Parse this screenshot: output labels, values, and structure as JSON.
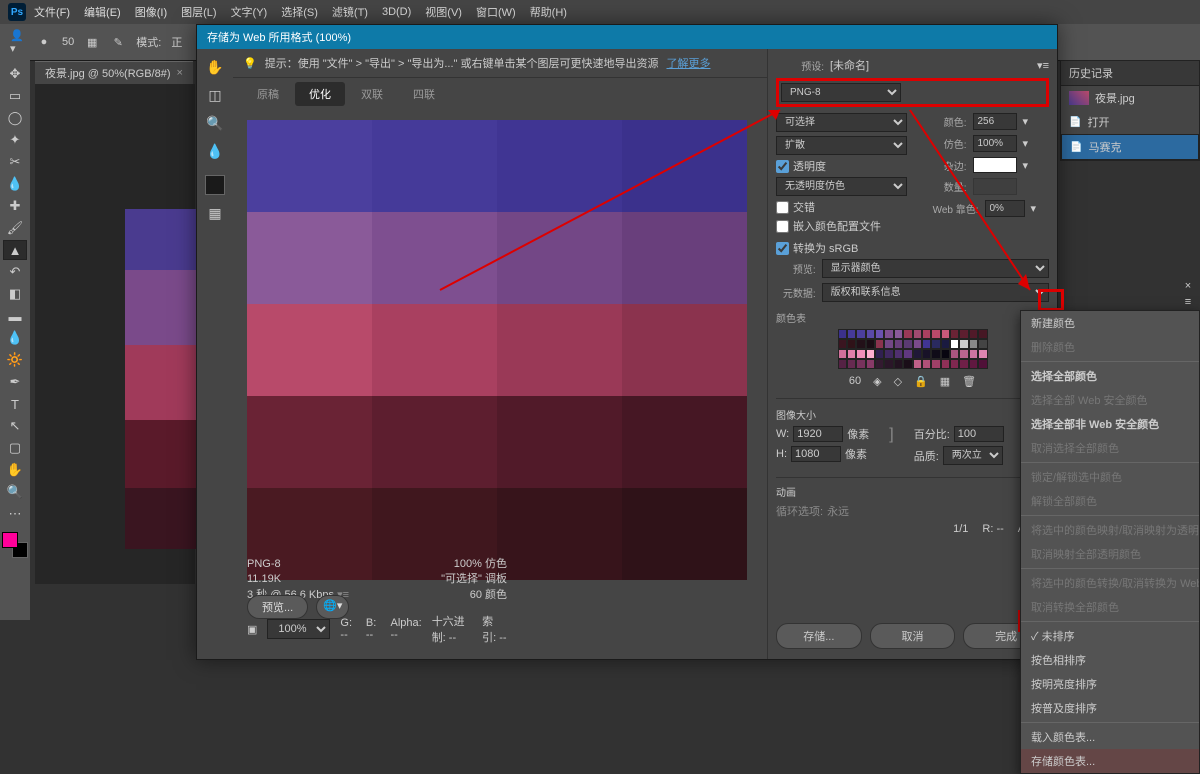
{
  "app": {
    "title": "Ps"
  },
  "menu": [
    "文件(F)",
    "编辑(E)",
    "图像(I)",
    "图层(L)",
    "文字(Y)",
    "选择(S)",
    "滤镜(T)",
    "3D(D)",
    "视图(V)",
    "窗口(W)",
    "帮助(H)"
  ],
  "optbar": {
    "brush_size": "50",
    "mode_label": "模式:",
    "mode_value": "正"
  },
  "doctab": {
    "name": "夜景.jpg @ 50%(RGB/8#)",
    "close": "×"
  },
  "dialog": {
    "title": "存储为 Web 所用格式 (100%)",
    "hint_text": "提示：使用 \"文件\" > \"导出\" > \"导出为...\" 或右键单击某个图层可更快速地导出资源",
    "hint_link": "了解更多",
    "tabs": [
      "原稿",
      "优化",
      "双联",
      "四联"
    ],
    "info": {
      "format": "PNG-8",
      "size": "11.19K",
      "time": "3 秒 @ 56.6 Kbps"
    },
    "info2": {
      "dither": "100% 仿色",
      "palette": "\"可选择\" 调板",
      "colors": "60 颜色"
    },
    "zoom": "100%",
    "readouts": {
      "g": "G: --",
      "b": "B: --",
      "alpha": "Alpha: --",
      "hex": "十六进制: --",
      "index": "索引: --"
    },
    "preview_btn": "预览...",
    "btns": {
      "save": "存储...",
      "cancel": "取消",
      "done": "完成"
    }
  },
  "settings": {
    "preset_label": "预设:",
    "preset_value": "[未命名]",
    "format": "PNG-8",
    "reduction_label": "可选择",
    "diffusion": "扩散",
    "colors_label": "颜色:",
    "colors": "256",
    "dither_label": "仿色:",
    "dither": "100%",
    "transparency": "透明度",
    "matte_label": "杂边:",
    "notrans": "无透明度仿色",
    "amount_label": "数量:",
    "interlace": "交错",
    "web_label": "Web 靠色:",
    "web_value": "0%",
    "embed": "嵌入颜色配置文件",
    "convert": "转换为 sRGB",
    "preview_label": "预览:",
    "preview_value": "显示器颜色",
    "metadata_label": "元数据:",
    "metadata_value": "版权和联系信息",
    "colortable_label": "颜色表",
    "colortable_count": "60",
    "imagesize_label": "图像大小",
    "w_label": "W:",
    "w": "1920",
    "h_label": "H:",
    "h": "1080",
    "px": "像素",
    "percent_label": "百分比:",
    "percent": "100",
    "quality_label": "品质:",
    "quality": "两次立方",
    "anim_label": "动画",
    "loop_label": "循环选项:",
    "loop_value": "永远",
    "frame": "1/1",
    "r_readout": "R: --",
    "alpha_readout": "Alpha:"
  },
  "ctxmenu": [
    {
      "t": "新建颜色",
      "d": false
    },
    {
      "t": "删除颜色",
      "d": true
    },
    "-",
    {
      "t": "选择全部颜色",
      "d": false,
      "b": true
    },
    {
      "t": "选择全部 Web 安全颜色",
      "d": true
    },
    {
      "t": "选择全部非 Web 安全颜色",
      "d": false,
      "b": true
    },
    {
      "t": "取消选择全部颜色",
      "d": true
    },
    "-",
    {
      "t": "锁定/解锁选中颜色",
      "d": true
    },
    {
      "t": "解锁全部颜色",
      "d": true
    },
    "-",
    {
      "t": "将选中的颜色映射/取消映射为透明",
      "d": true
    },
    {
      "t": "取消映射全部透明颜色",
      "d": true
    },
    "-",
    {
      "t": "将选中的颜色转换/取消转换为 Web 调色",
      "d": true
    },
    {
      "t": "取消转换全部颜色",
      "d": true
    },
    "-",
    {
      "t": "未排序",
      "d": false,
      "chk": true
    },
    {
      "t": "按色相排序",
      "d": false
    },
    {
      "t": "按明亮度排序",
      "d": false
    },
    {
      "t": "按普及度排序",
      "d": false
    },
    "-",
    {
      "t": "载入颜色表...",
      "d": false
    },
    {
      "t": "存储颜色表...",
      "d": false,
      "hl": true
    }
  ],
  "history": {
    "title": "历史记录",
    "doc": "夜景.jpg",
    "items": [
      "打开",
      "马赛克"
    ]
  },
  "grid_colors": [
    "#4b3f9e",
    "#453a99",
    "#403593",
    "#3b318c",
    "#8a5a99",
    "#7e4f90",
    "#734786",
    "#693f7c",
    "#b84a6a",
    "#a94060",
    "#9a3957",
    "#8b334e",
    "#6a2335",
    "#5d1e2f",
    "#511a29",
    "#461724",
    "#4a1a22",
    "#40171e",
    "#37141b",
    "#2f1218"
  ],
  "ct_colors": [
    "#3b318c",
    "#453a99",
    "#4b3f9e",
    "#5a4aa8",
    "#6a52b0",
    "#7e4f90",
    "#8a5a99",
    "#9a3957",
    "#a04a70",
    "#a94060",
    "#b84a6a",
    "#c85a7a",
    "#6a2335",
    "#5d1e2f",
    "#511a29",
    "#461724",
    "#3a1520",
    "#2f1218",
    "#221018",
    "#1a0c14",
    "#8b334e",
    "#734786",
    "#693f7c",
    "#5a3a72",
    "#7a4a8a",
    "#403593",
    "#2a2a60",
    "#1a1a40",
    "#ffffff",
    "#cccccc",
    "#888888",
    "#444444",
    "#d0709a",
    "#e080aa",
    "#f090ba",
    "#ffb0d0",
    "#302050",
    "#402860",
    "#503070",
    "#603880",
    "#201838",
    "#181228",
    "#100c18",
    "#080610",
    "#aa5580",
    "#bb6590",
    "#cc75a0",
    "#dd85b0",
    "#552244",
    "#662a50",
    "#77325c",
    "#883a68",
    "#331a30",
    "#2a1628",
    "#221220",
    "#1a0e18",
    "#c06088",
    "#b05078",
    "#a04068",
    "#903058",
    "#802850",
    "#702048",
    "#601840",
    "#501038"
  ]
}
